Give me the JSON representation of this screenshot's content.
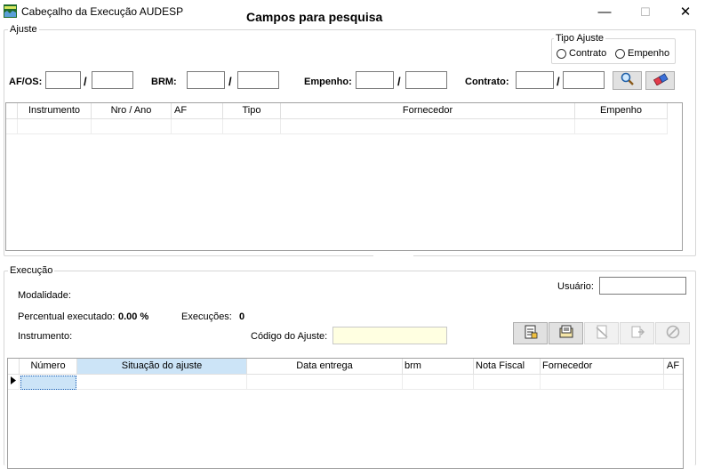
{
  "window": {
    "title": "Cabeçalho da Execução AUDESP",
    "header_title": "Campos para pesquisa",
    "minimize_glyph": "—",
    "maximize_glyph": "☐",
    "close_glyph": "✕"
  },
  "ajuste": {
    "group_label": "Ajuste",
    "tipo_ajuste": {
      "label": "Tipo Ajuste",
      "options": [
        "Contrato",
        "Empenho"
      ]
    },
    "filters": {
      "af_os_label": "AF/OS:",
      "brm_label": "BRM:",
      "empenho_label": "Empenho:",
      "contrato_label": "Contrato:",
      "slash": "/"
    },
    "grid_columns": [
      "Instrumento",
      "Nro / Ano",
      "AF",
      "Tipo",
      "Fornecedor",
      "Empenho"
    ]
  },
  "execucao": {
    "group_label": "Execução",
    "modalidade_label": "Modalidade:",
    "usuario_label": "Usuário:",
    "percentual_label": "Percentual executado:",
    "percentual_value": "0.00 %",
    "execucoes_label": "Execuções:",
    "execucoes_value": "0",
    "instrumento_label": "Instrumento:",
    "codigo_label": "Código do Ajuste:",
    "grid_columns": [
      "Número",
      "Situação do ajuste",
      "Data entrega",
      "brm",
      "Nota Fiscal",
      "Fornecedor",
      "AF"
    ]
  },
  "colors": {
    "selected_header": "#cce4f7",
    "codigo_field_bg": "#ffffe1",
    "group_border": "#d6d6d6"
  }
}
